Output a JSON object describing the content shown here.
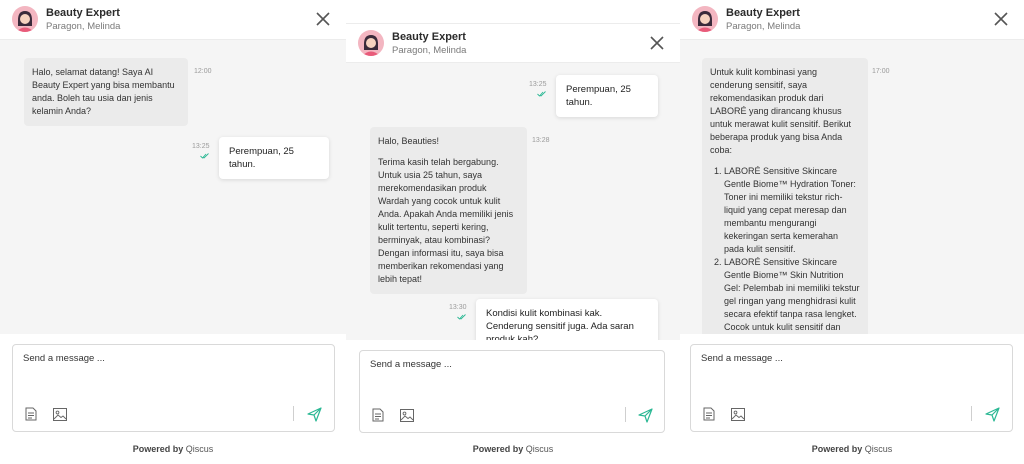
{
  "colors": {
    "accent": "#2bb894",
    "incoming_bg": "#ebebeb",
    "chat_bg": "#f5f5f5"
  },
  "header": {
    "name": "Beauty Expert",
    "subtitle": "Paragon, Melinda"
  },
  "composer": {
    "placeholder": "Send a message ..."
  },
  "footer": {
    "powered_label": "Powered by",
    "powered_brand": "Qiscus"
  },
  "icons": {
    "close": "close-icon",
    "send": "send-icon",
    "attach_doc": "document-icon",
    "attach_img": "image-icon",
    "read": "double-check-icon"
  },
  "panel1": {
    "in1": {
      "text": "Halo, selamat datang! Saya AI Beauty Expert yang bisa membantu anda. Boleh tau usia dan jenis kelamin Anda?",
      "time": "12:00"
    },
    "out1": {
      "text": "Perempuan, 25 tahun.",
      "time": "13:25"
    }
  },
  "panel2": {
    "out1": {
      "text": "Perempuan, 25 tahun.",
      "time": "13:25"
    },
    "in1": {
      "greeting": "Halo, Beauties!",
      "body": "Terima kasih telah bergabung. Untuk usia 25 tahun, saya merekomendasikan produk Wardah yang cocok untuk kulit Anda. Apakah Anda memiliki jenis kulit tertentu, seperti kering, berminyak, atau kombinasi? Dengan informasi itu, saya bisa memberikan rekomendasi yang lebih tepat!",
      "time": "13:28"
    },
    "out2": {
      "text": "Kondisi kulit kombinasi kak. Cenderung sensitif juga. Ada saran produk kah?",
      "time": "13:30"
    }
  },
  "panel3": {
    "in1": {
      "intro": "Untuk kulit kombinasi yang cenderung sensitif, saya rekomendasikan produk dari LABORÉ yang dirancang khusus untuk merawat kulit sensitif. Berikut beberapa produk yang bisa Anda coba:",
      "items": [
        "LABORÉ Sensitive Skincare Gentle Biome™ Hydration Toner: Toner ini memiliki tekstur rich-liquid yang cepat meresap dan membantu mengurangi kekeringan serta kemerahan pada kulit sensitif.",
        "LABORÉ Sensitive Skincare Gentle Biome™ Skin Nutrition Gel: Pelembab ini memiliki tekstur gel ringan yang menghidrasi kulit secara efektif tanpa rasa lengket. Cocok untuk kulit sensitif dan berjerawat."
      ],
      "time": "17:00"
    }
  }
}
